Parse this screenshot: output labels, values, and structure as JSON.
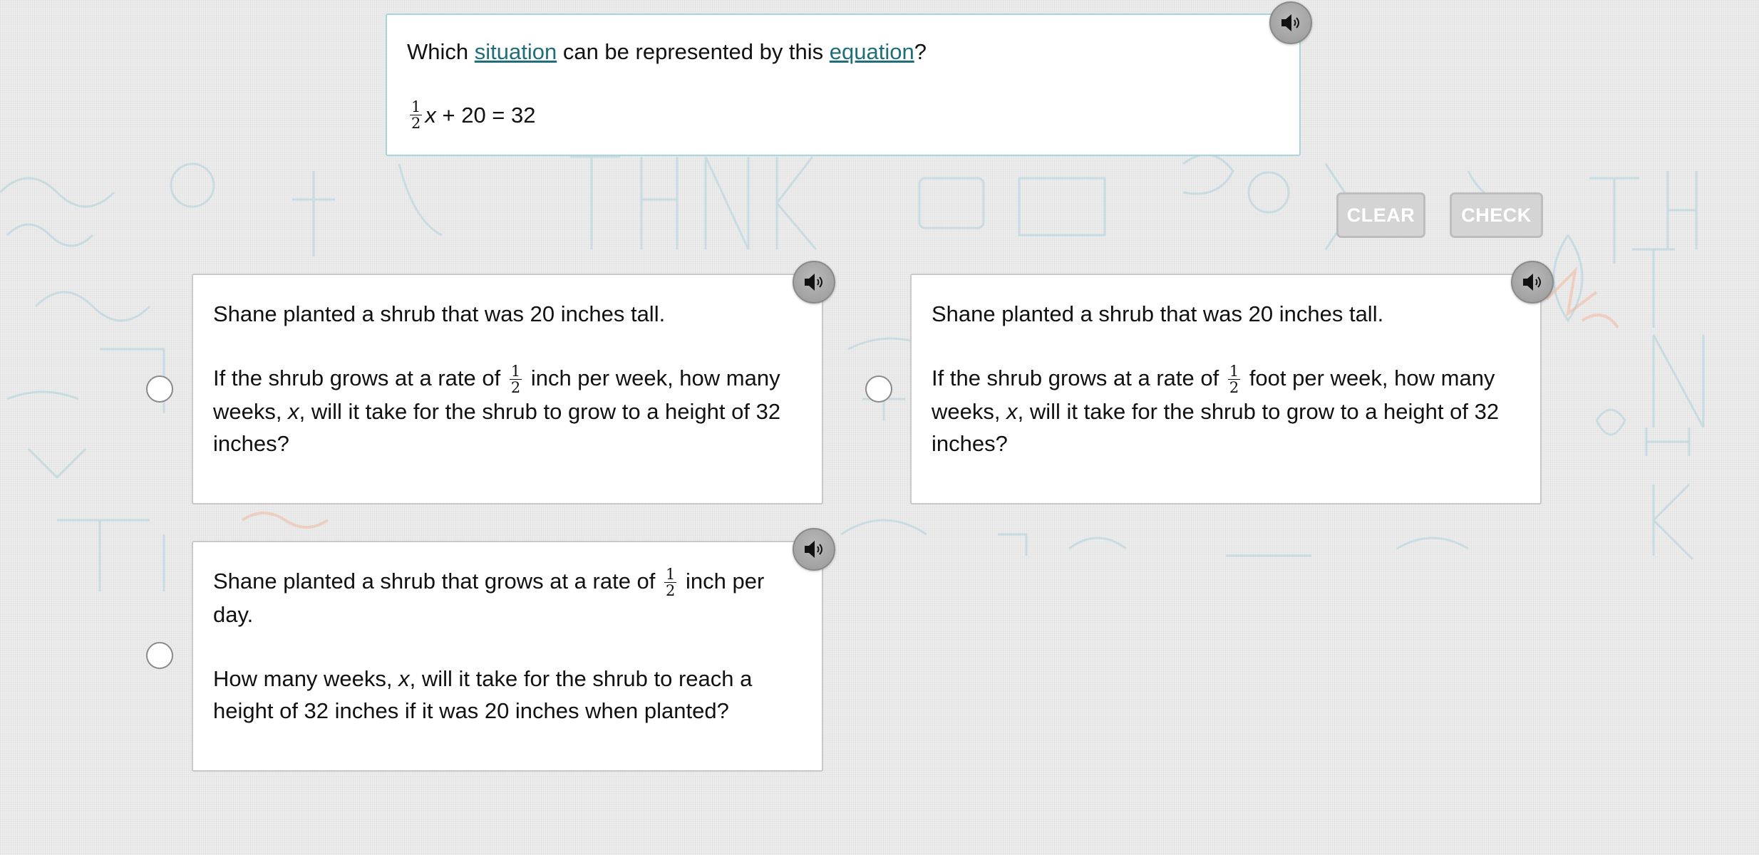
{
  "question": {
    "prefix": "Which ",
    "link1": "situation",
    "middle": " can be represented by this ",
    "link2": "equation",
    "suffix": "?",
    "equation": {
      "frac_num": "1",
      "frac_den": "2",
      "var": "x",
      "rest": " + 20 = 32"
    },
    "audio_icon": "speaker-icon"
  },
  "buttons": {
    "clear": "CLEAR",
    "check": "CHECK"
  },
  "answers": [
    {
      "p1": "Shane planted a shrub that was 20 inches tall.",
      "p2_a": "If the shrub grows at a rate of ",
      "frac_num": "1",
      "frac_den": "2",
      "p2_b": " inch per week, how many weeks, ",
      "var": "x",
      "p2_c": ", will it take for the shrub to grow to a height of 32 inches?"
    },
    {
      "p1": "Shane planted a shrub that was 20 inches tall.",
      "p2_a": "If the shrub grows at a rate of ",
      "frac_num": "1",
      "frac_den": "2",
      "p2_b": " foot per week, how many weeks, ",
      "var": "x",
      "p2_c": ", will it take for the shrub to grow to a height of 32 inches?"
    },
    {
      "p1_a": "Shane planted a shrub that grows at a rate of ",
      "frac_num": "1",
      "frac_den": "2",
      "p1_b": " inch per day.",
      "p2_a": "How many weeks, ",
      "var": "x",
      "p2_b": ", will it take for the shrub to reach a height of 32 inches if it was 20 inches when planted?"
    }
  ],
  "colors": {
    "accent_link": "#1f6f7a",
    "card_border_question": "#a8d6dd",
    "button_disabled": "#d4d4d4",
    "doodle_blue": "#9fcbd9",
    "doodle_orange": "#f1b59b"
  }
}
